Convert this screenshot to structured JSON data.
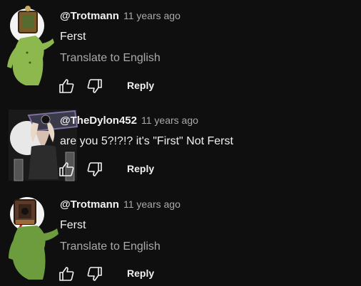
{
  "comments": [
    {
      "handle": "@Trotmann",
      "time": "11 years ago",
      "text": "Ferst",
      "translate": "Translate to English",
      "reply_label": "Reply"
    },
    {
      "handle": "@TheDylon452",
      "time": "11 years ago",
      "text": "are you 5?!?!? it's \"First\" Not Ferst",
      "reply_label": "Reply"
    },
    {
      "handle": "@Trotmann",
      "time": "11 years ago",
      "text": "Ferst",
      "translate": "Translate to English",
      "reply_label": "Reply"
    }
  ],
  "icons": {
    "like": "thumbs-up-icon",
    "dislike": "thumbs-down-icon"
  },
  "colors": {
    "background": "#0f0f0f",
    "text_primary": "#f1f1f1",
    "text_secondary": "#aaaaaa"
  }
}
